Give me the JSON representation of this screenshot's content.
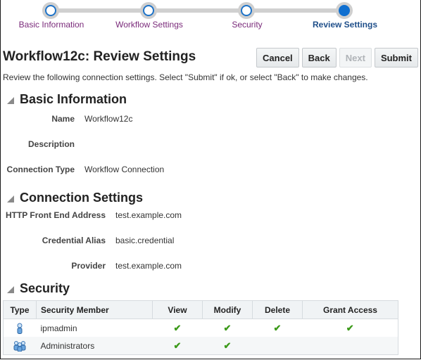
{
  "train": {
    "steps": [
      {
        "label": "Basic Information",
        "state": "visited"
      },
      {
        "label": "Workflow Settings",
        "state": "visited"
      },
      {
        "label": "Security",
        "state": "visited"
      },
      {
        "label": "Review Settings",
        "state": "current"
      }
    ]
  },
  "header": {
    "title": "Workflow12c: Review Settings",
    "buttons": {
      "cancel": "Cancel",
      "back": "Back",
      "next": "Next",
      "submit": "Submit"
    },
    "instructions": "Review the following connection settings. Select \"Submit\" if ok, or select \"Back\" to make changes."
  },
  "basic_info": {
    "heading": "Basic Information",
    "name_label": "Name",
    "name_value": "Workflow12c",
    "description_label": "Description",
    "description_value": "",
    "type_label": "Connection Type",
    "type_value": "Workflow Connection"
  },
  "connection": {
    "heading": "Connection Settings",
    "http_label": "HTTP Front End Address",
    "http_value": "test.example.com",
    "alias_label": "Credential Alias",
    "alias_value": "basic.credential",
    "provider_label": "Provider",
    "provider_value": "test.example.com"
  },
  "security": {
    "heading": "Security",
    "columns": [
      "Type",
      "Security Member",
      "View",
      "Modify",
      "Delete",
      "Grant Access"
    ],
    "rows": [
      {
        "type": "user-icon",
        "member": "ipmadmin",
        "view": true,
        "modify": true,
        "delete": true,
        "grant": true
      },
      {
        "type": "group-icon",
        "member": "Administrators",
        "view": true,
        "modify": true,
        "delete": false,
        "grant": false
      }
    ],
    "check_glyph": "✔"
  },
  "colors": {
    "accent": "#0f6fd0",
    "train_label": "#7a2a7a",
    "check": "#3c9a1a"
  }
}
